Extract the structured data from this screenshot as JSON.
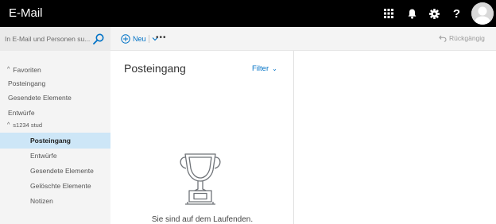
{
  "header": {
    "app_title": "E-Mail",
    "icons": [
      "app-launcher-icon",
      "bell-icon",
      "gear-icon",
      "help-icon",
      "avatar"
    ],
    "help_glyph": "?"
  },
  "toolbar": {
    "search_placeholder": "In E-Mail und Personen su...",
    "new_label": "Neu",
    "more_label": "•••",
    "undo_label": "Rückgängig"
  },
  "sidebar": {
    "items": [
      {
        "label": "Favoriten",
        "kind": "group",
        "expanded": true
      },
      {
        "label": "Posteingang",
        "kind": "folder"
      },
      {
        "label": "Gesendete Elemente",
        "kind": "folder"
      },
      {
        "label": "Entwürfe",
        "kind": "folder"
      },
      {
        "label": "s1234 stud",
        "kind": "group",
        "expanded": true
      },
      {
        "label": "Posteingang",
        "kind": "folder",
        "selected": true
      },
      {
        "label": "Entwürfe",
        "kind": "folder"
      },
      {
        "label": "Gesendete Elemente",
        "kind": "folder"
      },
      {
        "label": "Gelöschte Elemente",
        "kind": "folder"
      },
      {
        "label": "Notizen",
        "kind": "folder"
      }
    ]
  },
  "message_list": {
    "title": "Posteingang",
    "filter_label": "Filter",
    "empty_message": "Sie sind auf dem Laufenden."
  },
  "colors": {
    "topbar": "#000000",
    "accent": "#0072c6",
    "selected_folder": "#cde6f7",
    "pane": "#f4f4f4"
  }
}
